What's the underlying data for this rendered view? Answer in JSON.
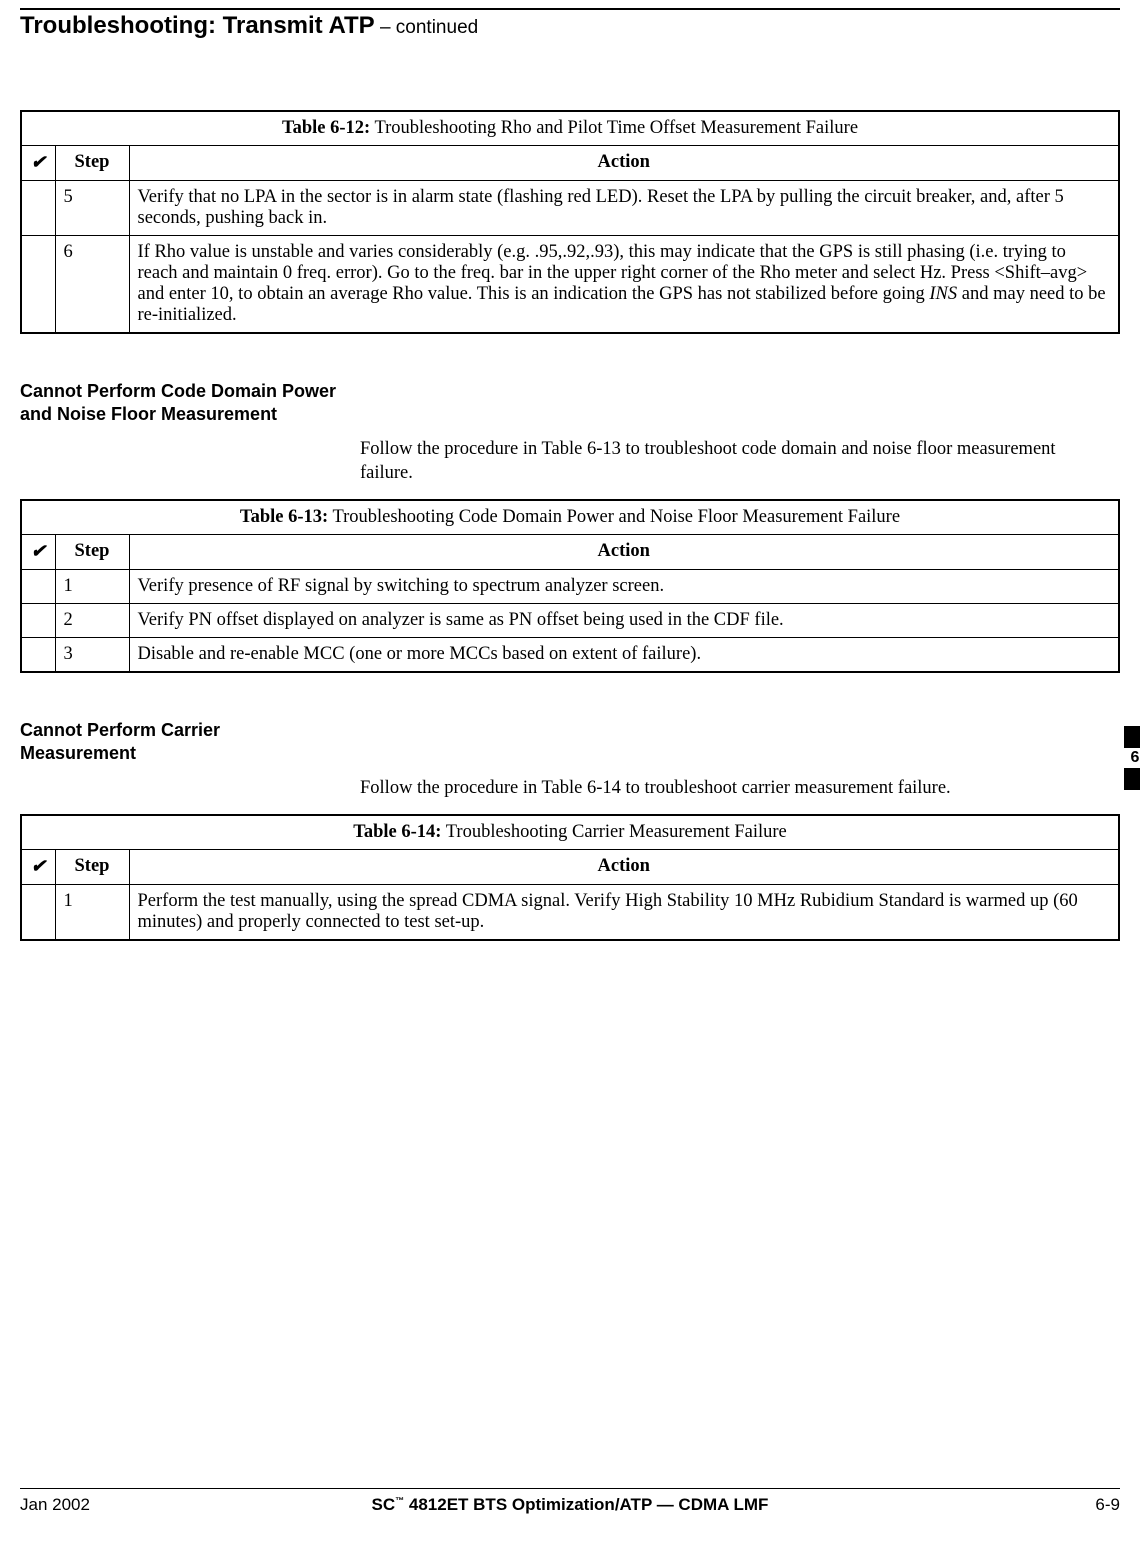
{
  "header": {
    "title_bold": "Troubleshooting: Transmit ATP",
    "title_cont": " – continued"
  },
  "table612": {
    "label": "Table 6-12:",
    "caption": " Troubleshooting Rho and Pilot Time Offset Measurement Failure",
    "check_glyph": "✔",
    "col_step": "Step",
    "col_action": "Action",
    "rows": [
      {
        "step": "5",
        "action": "Verify that no LPA in the sector is in alarm state (flashing red LED). Reset the LPA by pulling the circuit breaker, and, after 5 seconds, pushing back in."
      },
      {
        "step": "6",
        "action_pre": "If Rho value is unstable and varies considerably (e.g. .95,.92,.93), this may indicate that the GPS is still phasing (i.e. trying to reach and maintain 0 freq. error). Go to the freq. bar in the upper right corner of the Rho meter and select Hz. Press <Shift–avg> and enter 10, to obtain an average Rho value. This is an indication the GPS has not stabilized before going ",
        "action_ital": "INS",
        "action_post": " and may need to be re-initialized."
      }
    ]
  },
  "section_cd": {
    "heading": "Cannot Perform Code Domain Power and Noise Floor Measurement",
    "body": "Follow the procedure in Table 6-13 to troubleshoot code domain and noise floor measurement failure."
  },
  "table613": {
    "label": "Table 6-13:",
    "caption": " Troubleshooting Code Domain Power and Noise Floor Measurement Failure",
    "check_glyph": "✔",
    "col_step": "Step",
    "col_action": "Action",
    "rows": [
      {
        "step": "1",
        "action": "Verify presence of RF signal by switching to spectrum analyzer screen."
      },
      {
        "step": "2",
        "action": "Verify PN offset displayed on analyzer is same as PN offset being used in the CDF file."
      },
      {
        "step": "3",
        "action": "Disable and re-enable MCC (one or more MCCs based on extent of failure)."
      }
    ]
  },
  "section_cm": {
    "heading": "Cannot Perform Carrier Measurement",
    "body": "Follow the procedure in Table 6-14 to troubleshoot carrier measurement failure."
  },
  "table614": {
    "label": "Table 6-14:",
    "caption": " Troubleshooting Carrier Measurement Failure",
    "check_glyph": "✔",
    "col_step": "Step",
    "col_action": "Action",
    "rows": [
      {
        "step": "1",
        "action": "Perform the test manually, using the spread CDMA signal. Verify High Stability 10 MHz Rubidium Standard is warmed up (60 minutes) and properly connected to test set-up."
      }
    ]
  },
  "side_tab": {
    "num": "6"
  },
  "footer": {
    "left": "Jan 2002",
    "center_pre": "SC",
    "center_tm": "™",
    "center_post": " 4812ET BTS Optimization/ATP — CDMA LMF",
    "right": "6-9"
  }
}
